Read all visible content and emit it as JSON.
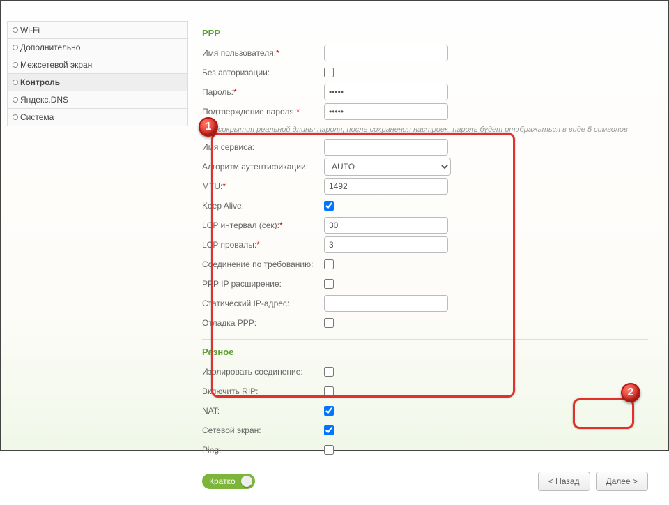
{
  "sidebar": {
    "items": [
      {
        "label": "Wi-Fi"
      },
      {
        "label": "Дополнительно"
      },
      {
        "label": "Межсетевой экран"
      },
      {
        "label": "Контроль"
      },
      {
        "label": "Яндекс.DNS"
      },
      {
        "label": "Система"
      }
    ]
  },
  "ppp": {
    "title": "PPP",
    "username_label": "Имя пользователя:",
    "username_value": "",
    "noauth_label": "Без авторизации:",
    "password_label": "Пароль:",
    "password_value": "•••••",
    "password2_label": "Подтверждение пароля:",
    "password2_value": "•••••",
    "hint": "Для сокрытия реальной длины пароля, после сохранения настроек, пароль будет отображаться в виде 5 символов",
    "service_label": "Имя сервиса:",
    "service_value": "",
    "auth_label": "Алгоритм аутентификации:",
    "auth_value": "AUTO",
    "mtu_label": "MTU:",
    "mtu_value": "1492",
    "keepalive_label": "Keep Alive:",
    "lcp_interval_label": "LCP интервал (сек):",
    "lcp_interval_value": "30",
    "lcp_fail_label": "LCP провалы:",
    "lcp_fail_value": "3",
    "ondemand_label": "Соединение по требованию:",
    "pppip_label": "PPP IP расширение:",
    "staticip_label": "Статический IP-адрес:",
    "staticip_value": "",
    "debug_label": "Отладка PPP:"
  },
  "misc": {
    "title": "Разное",
    "isolate_label": "Изолировать соединение:",
    "rip_label": "Включить RIP:",
    "nat_label": "NAT:",
    "firewall_label": "Сетевой экран:",
    "ping_label": "Ping:"
  },
  "footer": {
    "brief": "Кратко",
    "back": "< Назад",
    "next": "Далее >"
  },
  "markers": {
    "one": "1",
    "two": "2"
  }
}
